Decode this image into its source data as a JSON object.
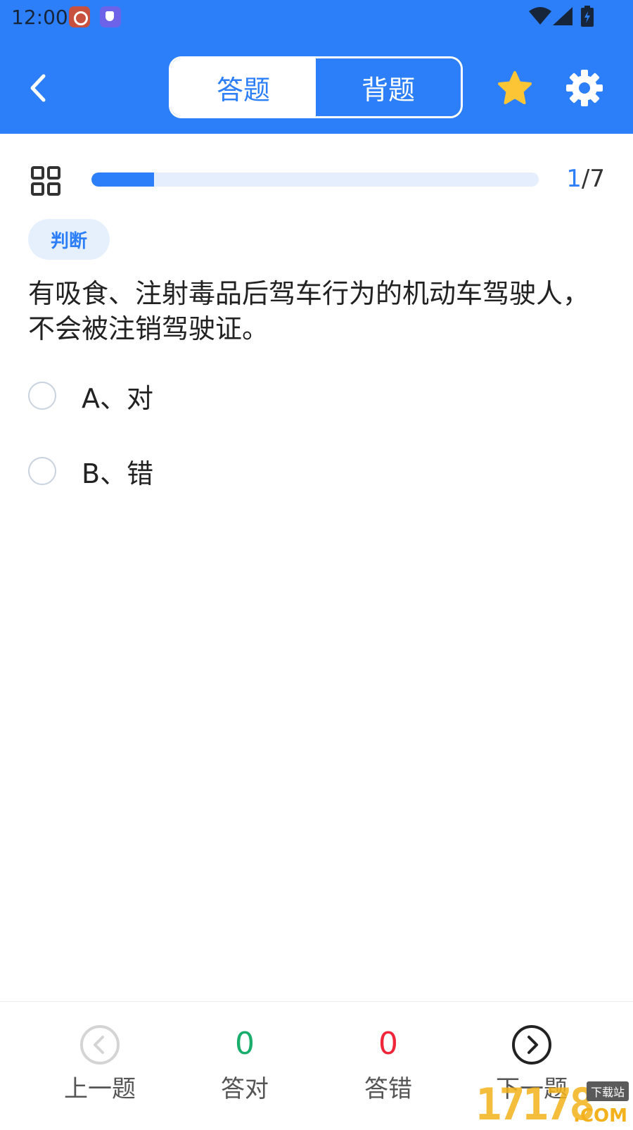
{
  "status_bar": {
    "time": "12:00"
  },
  "header": {
    "tabs": [
      {
        "label": "答题",
        "selected": true
      },
      {
        "label": "背题",
        "selected": false
      }
    ]
  },
  "progress": {
    "current": "1",
    "separator": "/",
    "total": "7",
    "fraction": 0.14
  },
  "question": {
    "type_tag": "判断",
    "text": "有吸食、注射毒品后驾车行为的机动车驾驶人，不会被注销驾驶证。",
    "options": [
      {
        "label": "A、对",
        "selected": false
      },
      {
        "label": "B、错",
        "selected": false
      }
    ]
  },
  "bottom_bar": {
    "prev_label": "上一题",
    "correct_count": "0",
    "correct_label": "答对",
    "wrong_count": "0",
    "wrong_label": "答错",
    "next_label": "下一题"
  },
  "watermark": {
    "digits": "17178",
    "tag": "下载站",
    "suffix": ".COM"
  },
  "colors": {
    "primary": "#2c7ff8",
    "correct": "#1aad6b",
    "wrong": "#f0253a"
  }
}
